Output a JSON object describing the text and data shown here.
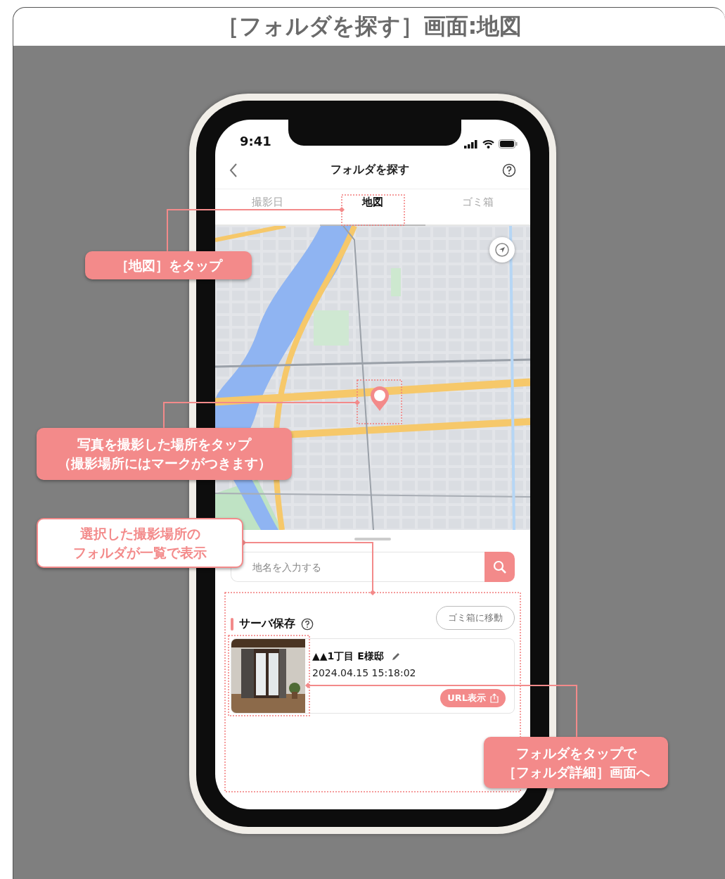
{
  "title": "［フォルダを探す］画面:地図",
  "phone": {
    "status_bar": {
      "time": "9:41"
    },
    "header": {
      "title": "フォルダを探す"
    },
    "tabs": [
      {
        "label": "撮影日",
        "selected": false
      },
      {
        "label": "地図",
        "selected": true
      },
      {
        "label": "ゴミ箱",
        "selected": false
      }
    ],
    "search": {
      "placeholder": "地名を入力する"
    },
    "section": {
      "title": "サーバ保存",
      "action": "ゴミ箱に移動"
    },
    "folders": [
      {
        "name": "▲▲1丁目 E様邸",
        "date": "2024.04.15 15:18:02",
        "button": "URL表示"
      }
    ]
  },
  "callouts": [
    {
      "kind": "filled",
      "lines": [
        "［地図］をタップ"
      ]
    },
    {
      "kind": "filled",
      "lines": [
        "写真を撮影した場所をタップ",
        "（撮影場所にはマークがつきます）"
      ]
    },
    {
      "kind": "outline",
      "lines": [
        "選択した撮影場所の",
        "フォルダが一覧で表示"
      ]
    },
    {
      "kind": "filled",
      "lines": [
        "フォルダをタップで",
        "［フォルダ詳細］画面へ"
      ]
    }
  ]
}
